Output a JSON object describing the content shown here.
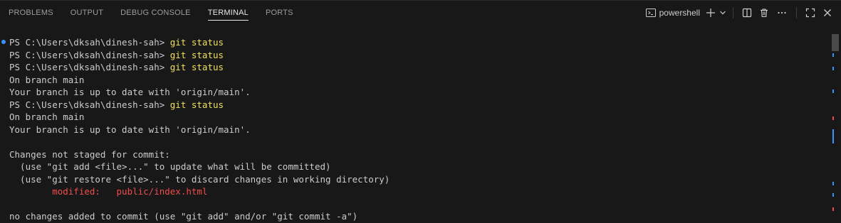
{
  "tabs": [
    {
      "label": "PROBLEMS"
    },
    {
      "label": "OUTPUT"
    },
    {
      "label": "DEBUG CONSOLE"
    },
    {
      "label": "TERMINAL"
    },
    {
      "label": "PORTS"
    }
  ],
  "active_tab": "TERMINAL",
  "toolbar": {
    "profile_label": "powershell",
    "icons": [
      "terminal-icon",
      "plus-icon",
      "chevron-down-icon",
      "split-icon",
      "trash-icon",
      "ellipsis-icon",
      "maximize-icon",
      "close-icon"
    ]
  },
  "terminal": {
    "prompt": "PS C:\\Users\\dksah\\dinesh-sah> ",
    "lines": [
      {
        "prompt": "PS C:\\Users\\dksah\\dinesh-sah> ",
        "command": "git status"
      },
      {
        "prompt": "PS C:\\Users\\dksah\\dinesh-sah> ",
        "command": "git status"
      },
      {
        "prompt": "PS C:\\Users\\dksah\\dinesh-sah> ",
        "command": "git status"
      },
      {
        "text": "On branch main"
      },
      {
        "text": "Your branch is up to date with 'origin/main'."
      },
      {
        "prompt": "PS C:\\Users\\dksah\\dinesh-sah> ",
        "command": "git status"
      },
      {
        "text": "On branch main"
      },
      {
        "text": "Your branch is up to date with 'origin/main'."
      },
      {
        "text": ""
      },
      {
        "text": "Changes not staged for commit:"
      },
      {
        "text": "  (use \"git add <file>...\" to update what will be committed)"
      },
      {
        "text": "  (use \"git restore <file>...\" to discard changes in working directory)"
      },
      {
        "text": "        modified:   public/index.html"
      },
      {
        "text": ""
      },
      {
        "text": "no changes added to commit (use \"git add\" and/or \"git commit -a\")"
      }
    ]
  },
  "colors": {
    "background": "#181818",
    "text": "#cccccc",
    "command": "#f1e05a",
    "modified": "#f14c4c",
    "accent": "#3794ff"
  }
}
